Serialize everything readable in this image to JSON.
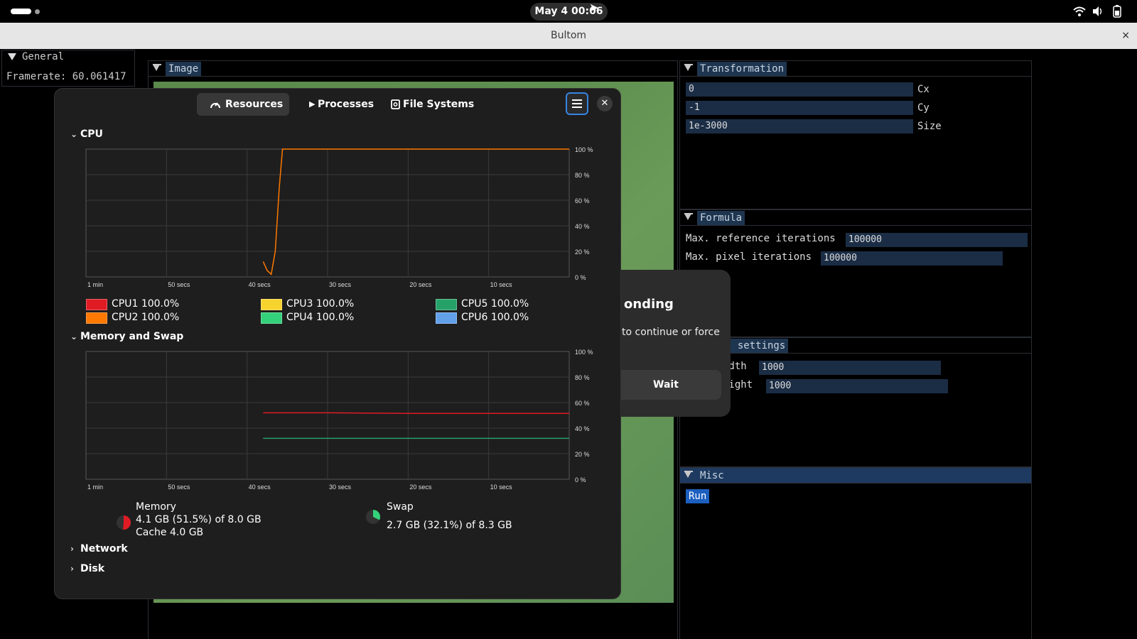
{
  "topbar": {
    "clock": "May 4  00:06"
  },
  "window": {
    "title": "Bultom",
    "close_glyph": "×"
  },
  "general": {
    "title": "General",
    "framerate": "Framerate: 60.061417"
  },
  "image_panel": {
    "title": "Image"
  },
  "transformation": {
    "title": "Transformation",
    "fields": [
      {
        "value": "0",
        "label": "Cx"
      },
      {
        "value": "-1",
        "label": "Cy"
      },
      {
        "value": "1e-3000",
        "label": "Size"
      }
    ]
  },
  "formula": {
    "title": "Formula",
    "max_ref_label": "Max. reference iterations",
    "max_ref_value": "100000",
    "max_pix_label": "Max. pixel iterations",
    "max_pix_value": "100000"
  },
  "output": {
    "title_partial": "t settings",
    "width_label": "idth",
    "width_value": "1000",
    "height_label": "eight",
    "height_value": "1000"
  },
  "misc": {
    "title": "Misc",
    "run_label": "Run"
  },
  "dialog": {
    "title_partial": "onding",
    "text_partial": "to continue or force",
    "wait_label": "Wait"
  },
  "resources": {
    "tabs": [
      "Resources",
      "Processes",
      "File Systems"
    ],
    "cpu_section": "CPU",
    "mem_section": "Memory and Swap",
    "network_section": "Network",
    "disk_section": "Disk",
    "cpu_legend": [
      {
        "label": "CPU1 100.0%",
        "color": "#e01b24"
      },
      {
        "label": "CPU2 100.0%",
        "color": "#ff7800"
      },
      {
        "label": "CPU3 100.0%",
        "color": "#f6d32d"
      },
      {
        "label": "CPU4 100.0%",
        "color": "#33d17a"
      },
      {
        "label": "CPU5 100.0%",
        "color": "#26a269"
      },
      {
        "label": "CPU6 100.0%",
        "color": "#62a0ea"
      }
    ],
    "memory": {
      "title": "Memory",
      "line1": "4.1 GB (51.5%) of 8.0 GB",
      "line2": "Cache 4.0 GB",
      "color": "#e01b24"
    },
    "swap": {
      "title": "Swap",
      "line1": "2.7 GB (32.1%) of 8.3 GB",
      "color": "#33d17a"
    }
  },
  "chart_data": [
    {
      "type": "line",
      "title": "CPU",
      "xticks": [
        "1 min",
        "50 secs",
        "40 secs",
        "30 secs",
        "20 secs",
        "10 secs"
      ],
      "yticks": [
        "100 %",
        "80 %",
        "60 %",
        "40 %",
        "20 %",
        "0 %"
      ],
      "ylim": [
        0,
        100
      ],
      "xlim": [
        -60,
        0
      ],
      "series": [
        {
          "name": "CPU2 100.0%",
          "color": "#ff7800",
          "x": [
            -38,
            -37.5,
            -37,
            -36.5,
            -36,
            -35.6,
            -35,
            -30,
            -20,
            -10,
            0
          ],
          "y": [
            12,
            5,
            2,
            20,
            70,
            100,
            100,
            100,
            100,
            100,
            100
          ]
        }
      ]
    },
    {
      "type": "line",
      "title": "Memory and Swap",
      "xticks": [
        "1 min",
        "50 secs",
        "40 secs",
        "30 secs",
        "20 secs",
        "10 secs"
      ],
      "yticks": [
        "100 %",
        "80 %",
        "60 %",
        "40 %",
        "20 %",
        "0 %"
      ],
      "ylim": [
        0,
        100
      ],
      "xlim": [
        -60,
        0
      ],
      "series": [
        {
          "name": "Memory",
          "color": "#e01b24",
          "x": [
            -38,
            -30,
            -20,
            -10,
            0
          ],
          "y": [
            52,
            52,
            51.5,
            51.5,
            51.5
          ]
        },
        {
          "name": "Swap",
          "color": "#26a269",
          "x": [
            -38,
            -30,
            -20,
            -10,
            0
          ],
          "y": [
            32,
            32,
            32,
            32,
            32
          ]
        }
      ]
    }
  ]
}
